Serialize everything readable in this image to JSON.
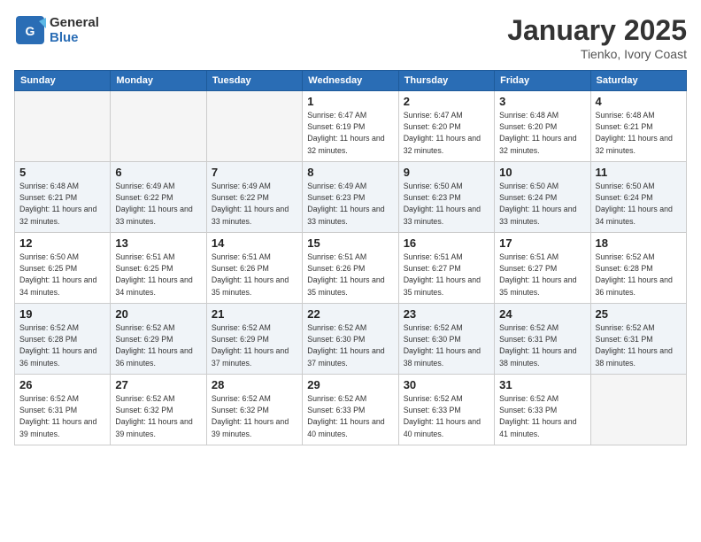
{
  "logo": {
    "line1": "General",
    "line2": "Blue"
  },
  "title": "January 2025",
  "subtitle": "Tienko, Ivory Coast",
  "weekdays": [
    "Sunday",
    "Monday",
    "Tuesday",
    "Wednesday",
    "Thursday",
    "Friday",
    "Saturday"
  ],
  "weeks": [
    [
      {
        "day": "",
        "empty": true
      },
      {
        "day": "",
        "empty": true
      },
      {
        "day": "",
        "empty": true
      },
      {
        "day": "1",
        "sunrise": "6:47 AM",
        "sunset": "6:19 PM",
        "daylight": "11 hours and 32 minutes."
      },
      {
        "day": "2",
        "sunrise": "6:47 AM",
        "sunset": "6:20 PM",
        "daylight": "11 hours and 32 minutes."
      },
      {
        "day": "3",
        "sunrise": "6:48 AM",
        "sunset": "6:20 PM",
        "daylight": "11 hours and 32 minutes."
      },
      {
        "day": "4",
        "sunrise": "6:48 AM",
        "sunset": "6:21 PM",
        "daylight": "11 hours and 32 minutes."
      }
    ],
    [
      {
        "day": "5",
        "sunrise": "6:48 AM",
        "sunset": "6:21 PM",
        "daylight": "11 hours and 32 minutes."
      },
      {
        "day": "6",
        "sunrise": "6:49 AM",
        "sunset": "6:22 PM",
        "daylight": "11 hours and 33 minutes."
      },
      {
        "day": "7",
        "sunrise": "6:49 AM",
        "sunset": "6:22 PM",
        "daylight": "11 hours and 33 minutes."
      },
      {
        "day": "8",
        "sunrise": "6:49 AM",
        "sunset": "6:23 PM",
        "daylight": "11 hours and 33 minutes."
      },
      {
        "day": "9",
        "sunrise": "6:50 AM",
        "sunset": "6:23 PM",
        "daylight": "11 hours and 33 minutes."
      },
      {
        "day": "10",
        "sunrise": "6:50 AM",
        "sunset": "6:24 PM",
        "daylight": "11 hours and 33 minutes."
      },
      {
        "day": "11",
        "sunrise": "6:50 AM",
        "sunset": "6:24 PM",
        "daylight": "11 hours and 34 minutes."
      }
    ],
    [
      {
        "day": "12",
        "sunrise": "6:50 AM",
        "sunset": "6:25 PM",
        "daylight": "11 hours and 34 minutes."
      },
      {
        "day": "13",
        "sunrise": "6:51 AM",
        "sunset": "6:25 PM",
        "daylight": "11 hours and 34 minutes."
      },
      {
        "day": "14",
        "sunrise": "6:51 AM",
        "sunset": "6:26 PM",
        "daylight": "11 hours and 35 minutes."
      },
      {
        "day": "15",
        "sunrise": "6:51 AM",
        "sunset": "6:26 PM",
        "daylight": "11 hours and 35 minutes."
      },
      {
        "day": "16",
        "sunrise": "6:51 AM",
        "sunset": "6:27 PM",
        "daylight": "11 hours and 35 minutes."
      },
      {
        "day": "17",
        "sunrise": "6:51 AM",
        "sunset": "6:27 PM",
        "daylight": "11 hours and 35 minutes."
      },
      {
        "day": "18",
        "sunrise": "6:52 AM",
        "sunset": "6:28 PM",
        "daylight": "11 hours and 36 minutes."
      }
    ],
    [
      {
        "day": "19",
        "sunrise": "6:52 AM",
        "sunset": "6:28 PM",
        "daylight": "11 hours and 36 minutes."
      },
      {
        "day": "20",
        "sunrise": "6:52 AM",
        "sunset": "6:29 PM",
        "daylight": "11 hours and 36 minutes."
      },
      {
        "day": "21",
        "sunrise": "6:52 AM",
        "sunset": "6:29 PM",
        "daylight": "11 hours and 37 minutes."
      },
      {
        "day": "22",
        "sunrise": "6:52 AM",
        "sunset": "6:30 PM",
        "daylight": "11 hours and 37 minutes."
      },
      {
        "day": "23",
        "sunrise": "6:52 AM",
        "sunset": "6:30 PM",
        "daylight": "11 hours and 38 minutes."
      },
      {
        "day": "24",
        "sunrise": "6:52 AM",
        "sunset": "6:31 PM",
        "daylight": "11 hours and 38 minutes."
      },
      {
        "day": "25",
        "sunrise": "6:52 AM",
        "sunset": "6:31 PM",
        "daylight": "11 hours and 38 minutes."
      }
    ],
    [
      {
        "day": "26",
        "sunrise": "6:52 AM",
        "sunset": "6:31 PM",
        "daylight": "11 hours and 39 minutes."
      },
      {
        "day": "27",
        "sunrise": "6:52 AM",
        "sunset": "6:32 PM",
        "daylight": "11 hours and 39 minutes."
      },
      {
        "day": "28",
        "sunrise": "6:52 AM",
        "sunset": "6:32 PM",
        "daylight": "11 hours and 39 minutes."
      },
      {
        "day": "29",
        "sunrise": "6:52 AM",
        "sunset": "6:33 PM",
        "daylight": "11 hours and 40 minutes."
      },
      {
        "day": "30",
        "sunrise": "6:52 AM",
        "sunset": "6:33 PM",
        "daylight": "11 hours and 40 minutes."
      },
      {
        "day": "31",
        "sunrise": "6:52 AM",
        "sunset": "6:33 PM",
        "daylight": "11 hours and 41 minutes."
      },
      {
        "day": "",
        "empty": true
      }
    ]
  ]
}
